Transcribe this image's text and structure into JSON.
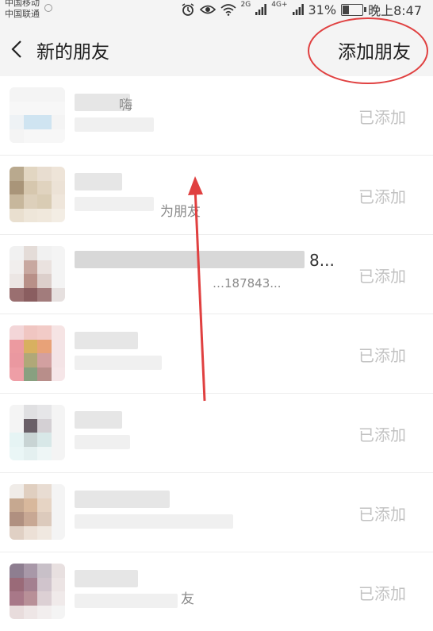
{
  "status_bar": {
    "carrier_1": "中国移动",
    "carrier_2": "中国联通",
    "net_1": "2G",
    "net_2": "4G+",
    "battery": "31%",
    "time": "晚上8:47",
    "icons": [
      "alarm-icon",
      "eye-icon",
      "wifi-icon",
      "signal-icon",
      "signal-icon",
      "battery-icon"
    ]
  },
  "header": {
    "back_icon": "chevron-left-icon",
    "title": "新的朋友",
    "action": "添加朋友",
    "highlight_color": "#e04040"
  },
  "friends": [
    {
      "name_fragment": "嗨",
      "sub_fragment": "",
      "status": "已添加"
    },
    {
      "name_fragment": "",
      "sub_fragment": "为朋友",
      "status": "已添加"
    },
    {
      "name_fragment": "8...",
      "sub_fragment": "…187843...",
      "status": "已添加"
    },
    {
      "name_fragment": "",
      "sub_fragment": "",
      "status": "已添加"
    },
    {
      "name_fragment": "",
      "sub_fragment": "",
      "status": "已添加"
    },
    {
      "name_fragment": "",
      "sub_fragment": "",
      "status": "已添加"
    },
    {
      "name_fragment": "",
      "sub_fragment": "友",
      "status": "已添加"
    }
  ],
  "colors": {
    "accent_red": "#e04040",
    "added_gray": "#c2c2c2"
  }
}
